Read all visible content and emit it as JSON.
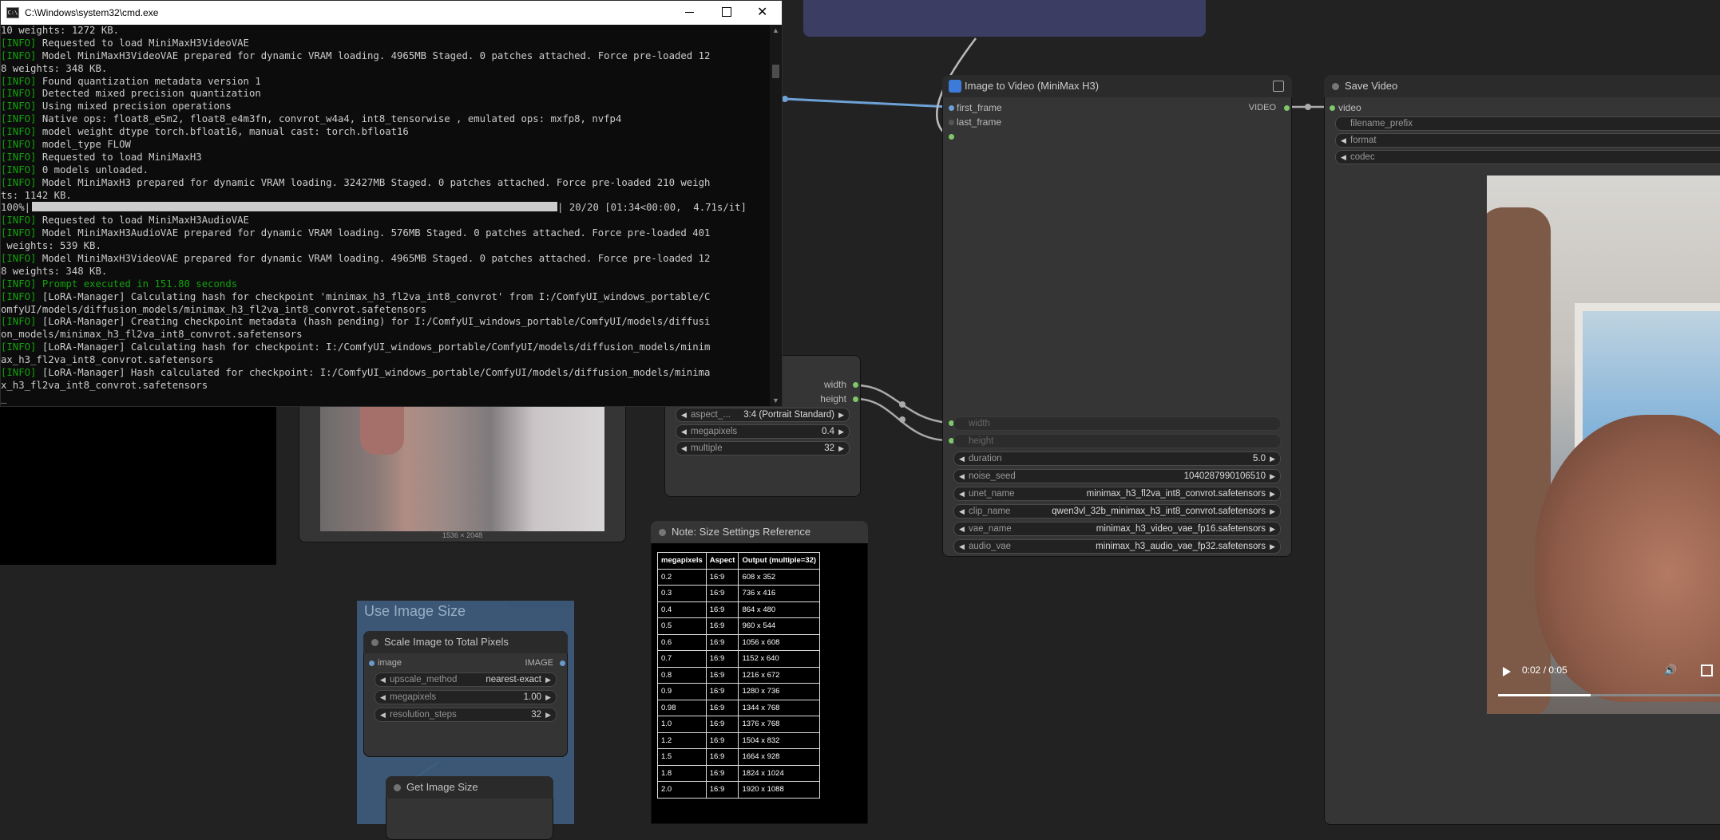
{
  "cmd": {
    "title": "C:\\Windows\\system32\\cmd.exe",
    "lines": [
      {
        "t": "10 weights: 1272 KB."
      },
      {
        "p": "[INFO]",
        "t": " Requested to load MiniMaxH3VideoVAE"
      },
      {
        "p": "[INFO]",
        "t": " Model MiniMaxH3VideoVAE prepared for dynamic VRAM loading. 4965MB Staged. 0 patches attached. Force pre-loaded 12"
      },
      {
        "t": "8 weights: 348 KB."
      },
      {
        "p": "[INFO]",
        "t": " Found quantization metadata version 1"
      },
      {
        "p": "[INFO]",
        "t": " Detected mixed precision quantization"
      },
      {
        "p": "[INFO]",
        "t": " Using mixed precision operations"
      },
      {
        "p": "[INFO]",
        "t": " Native ops: float8_e5m2, float8_e4m3fn, convrot_w4a4, int8_tensorwise , emulated ops: mxfp8, nvfp4"
      },
      {
        "p": "[INFO]",
        "t": " model weight dtype torch.bfloat16, manual cast: torch.bfloat16"
      },
      {
        "p": "[INFO]",
        "t": " model_type FLOW"
      },
      {
        "p": "[INFO]",
        "t": " Requested to load MiniMaxH3"
      },
      {
        "p": "[INFO]",
        "t": " 0 models unloaded."
      },
      {
        "p": "[INFO]",
        "t": " Model MiniMaxH3 prepared for dynamic VRAM loading. 32427MB Staged. 0 patches attached. Force pre-loaded 210 weigh"
      },
      {
        "t": "ts: 1142 KB."
      },
      {
        "progress": true,
        "left": "100%|",
        "right": "| 20/20 [01:34<00:00,  4.71s/it]"
      },
      {
        "p": "[INFO]",
        "t": " Requested to load MiniMaxH3AudioVAE"
      },
      {
        "p": "[INFO]",
        "t": " Model MiniMaxH3AudioVAE prepared for dynamic VRAM loading. 576MB Staged. 0 patches attached. Force pre-loaded 401"
      },
      {
        "t": " weights: 539 KB."
      },
      {
        "p": "[INFO]",
        "t": " Model MiniMaxH3VideoVAE prepared for dynamic VRAM loading. 4965MB Staged. 0 patches attached. Force pre-loaded 12"
      },
      {
        "t": "8 weights: 348 KB."
      },
      {
        "p": "[INFO]",
        "g": " Prompt executed in 151.80 seconds"
      },
      {
        "p": "[INFO]",
        "t": " [LoRA-Manager] Calculating hash for checkpoint 'minimax_h3_fl2va_int8_convrot' from I:/ComfyUI_windows_portable/C"
      },
      {
        "t": "omfyUI/models/diffusion_models/minimax_h3_fl2va_int8_convrot.safetensors"
      },
      {
        "p": "[INFO]",
        "t": " [LoRA-Manager] Creating checkpoint metadata (hash pending) for I:/ComfyUI_windows_portable/ComfyUI/models/diffusi"
      },
      {
        "t": "on_models/minimax_h3_fl2va_int8_convrot.safetensors"
      },
      {
        "p": "[INFO]",
        "t": " [LoRA-Manager] Calculating hash for checkpoint: I:/ComfyUI_windows_portable/ComfyUI/models/diffusion_models/minim"
      },
      {
        "t": "ax_h3_fl2va_int8_convrot.safetensors"
      },
      {
        "p": "[INFO]",
        "t": " [LoRA-Manager] Hash calculated for checkpoint: I:/ComfyUI_windows_portable/ComfyUI/models/diffusion_models/minima"
      },
      {
        "t": "x_h3_fl2va_int8_convrot.safetensors"
      },
      {
        "t": "_"
      }
    ]
  },
  "preview_image": {
    "caption": "1536 × 2048"
  },
  "resolution_node": {
    "outputs": [
      "width",
      "height"
    ],
    "widgets": [
      {
        "label": "aspect_...",
        "value": "3:4 (Portrait Standard)"
      },
      {
        "label": "megapixels",
        "value": "0.4"
      },
      {
        "label": "multiple",
        "value": "32"
      }
    ]
  },
  "i2v_node": {
    "title": "Image to Video (MiniMax H3)",
    "inputs": [
      "first_frame",
      "last_frame"
    ],
    "output": "VIDEO",
    "converted_inputs": [
      "width",
      "height"
    ],
    "widgets": [
      {
        "label": "duration",
        "value": "5.0"
      },
      {
        "label": "noise_seed",
        "value": "1040287990106510"
      },
      {
        "label": "unet_name",
        "value": "minimax_h3_fl2va_int8_convrot.safetensors"
      },
      {
        "label": "clip_name",
        "value": "qwen3vl_32b_minimax_h3_int8_convrot.safetensors"
      },
      {
        "label": "vae_name",
        "value": "minimax_h3_video_vae_fp16.safetensors"
      },
      {
        "label": "audio_vae",
        "value": "minimax_h3_audio_vae_fp32.safetensors"
      }
    ]
  },
  "save_video_node": {
    "title": "Save Video",
    "input": "video",
    "widgets": [
      "filename_prefix",
      "format",
      "codec"
    ],
    "player": {
      "time": "0:02 / 0:05",
      "progress": 0.4
    }
  },
  "note_node": {
    "title": "Note: Size Settings Reference",
    "headers": [
      "megapixels",
      "Aspect",
      "Output (multiple=32)"
    ],
    "rows": [
      [
        "0.2",
        "16:9",
        "608 x 352"
      ],
      [
        "0.3",
        "16:9",
        "736 x 416"
      ],
      [
        "0.4",
        "16:9",
        "864 x 480"
      ],
      [
        "0.5",
        "16:9",
        "960 x 544"
      ],
      [
        "0.6",
        "16:9",
        "1056 x 608"
      ],
      [
        "0.7",
        "16:9",
        "1152 x 640"
      ],
      [
        "0.8",
        "16:9",
        "1216 x 672"
      ],
      [
        "0.9",
        "16:9",
        "1280 x 736"
      ],
      [
        "0.98",
        "16:9",
        "1344 x 768"
      ],
      [
        "1.0",
        "16:9",
        "1376 x 768"
      ],
      [
        "1.2",
        "16:9",
        "1504 x 832"
      ],
      [
        "1.5",
        "16:9",
        "1664 x 928"
      ],
      [
        "1.8",
        "16:9",
        "1824 x 1024"
      ],
      [
        "2.0",
        "16:9",
        "1920 x 1088"
      ]
    ]
  },
  "group": {
    "title": "Use Image Size"
  },
  "scale_node": {
    "title": "Scale Image to Total Pixels",
    "input": "image",
    "output": "IMAGE",
    "widgets": [
      {
        "label": "upscale_method",
        "value": "nearest-exact"
      },
      {
        "label": "megapixels",
        "value": "1.00"
      },
      {
        "label": "resolution_steps",
        "value": "32"
      }
    ]
  },
  "get_size_node": {
    "title": "Get Image Size"
  },
  "colors": {
    "link_blue": "#6ea1d6",
    "socket_green": "#7ec86b",
    "group_blue": "#3d5a7a",
    "top_node": "#3b3d63"
  }
}
